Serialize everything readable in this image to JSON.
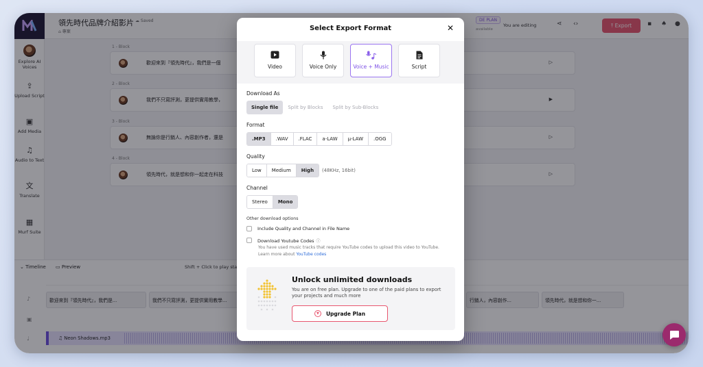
{
  "app": {
    "project_title": "領先時代品牌介紹影片",
    "saved_status": "Saved",
    "breadcrumb": "專案",
    "plan_chip": "DE PLAN",
    "plan_sub": "available",
    "editing_status": "You are editing",
    "export_label": "Export"
  },
  "sidebar": {
    "items": [
      {
        "label": "Explore AI Voices",
        "icon": "voice-avatar-icon"
      },
      {
        "label": "Upload Script",
        "icon": "upload-icon"
      },
      {
        "label": "Add Media",
        "icon": "media-icon"
      },
      {
        "label": "Audio to Text",
        "icon": "audio-text-icon"
      },
      {
        "label": "Translate",
        "icon": "translate-icon"
      },
      {
        "label": "Murf Suite",
        "icon": "suite-icon"
      }
    ]
  },
  "blocks": [
    {
      "label": "1 - Block",
      "text": "歡迎來到『領先時代』，我們是一個"
    },
    {
      "label": "2 - Block",
      "text": "我們不只寫評測，更提供實用教學，"
    },
    {
      "label": "3 - Block",
      "text": "無論你是行銷人、內容創作者，還是"
    },
    {
      "label": "4 - Block",
      "text": "領先時代，就是想和你一起走在科技"
    }
  ],
  "timeline": {
    "title": "Timeline",
    "preview": "Preview",
    "hint": "Shift + Click to play sta",
    "clips": [
      "歡迎來到『領先時代』，我們是...",
      "我們不只寫評測，更提供實用教學...",
      "行銷人，內容創作...",
      "領先時代，就是想和你一..."
    ],
    "music": "Neon Shadows.mp3"
  },
  "modal": {
    "title": "Select Export Format",
    "formats": [
      {
        "label": "Video",
        "icon": "video-icon"
      },
      {
        "label": "Voice Only",
        "icon": "microphone-icon"
      },
      {
        "label": "Voice + Music",
        "icon": "voice-music-icon"
      },
      {
        "label": "Script",
        "icon": "document-icon"
      }
    ],
    "selected_format": "Voice + Music",
    "download_as": {
      "label": "Download As",
      "options": [
        "Single file",
        "Split by Blocks",
        "Split by Sub-Blocks"
      ],
      "selected": "Single file"
    },
    "format": {
      "label": "Format",
      "options": [
        ".MP3",
        ".WAV",
        ".FLAC",
        "a-LAW",
        "μ-LAW",
        ".OGG"
      ],
      "selected": ".MP3"
    },
    "quality": {
      "label": "Quality",
      "options": [
        "Low",
        "Medium",
        "High"
      ],
      "selected": "High",
      "note": "(48KHz, 16bit)"
    },
    "channel": {
      "label": "Channel",
      "options": [
        "Stereo",
        "Mono"
      ],
      "selected": "Mono"
    },
    "other_options": {
      "label": "Other download options",
      "include_quality": "Include Quality and Channel in File Name",
      "youtube_codes": "Download Youtube Codes",
      "youtube_note": "You have used music tracks that require YouTube codes to upload this video to YouTube.",
      "learn_more": "Learn more about",
      "learn_link": "YouTube codes"
    },
    "upsell": {
      "title": "Unlock unlimited downloads",
      "desc": "You are on free plan. Upgrade to one of the paid plans to export your projects and much more",
      "button": "Upgrade Plan"
    }
  },
  "colors": {
    "accent": "#7e52e6",
    "export": "#e8556e",
    "chat": "#9b2a6d"
  }
}
